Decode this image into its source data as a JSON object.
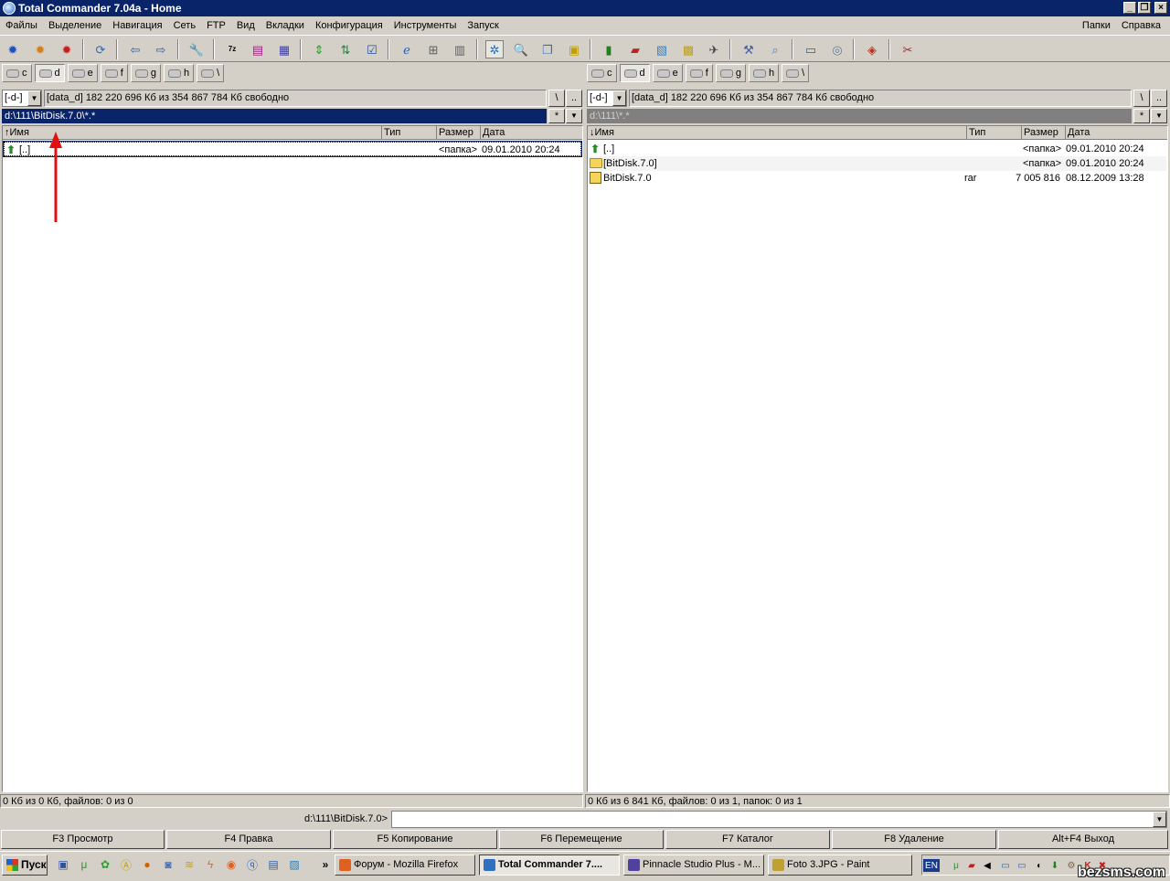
{
  "window": {
    "title": "Total Commander 7.04a - Home"
  },
  "menu": {
    "items": [
      "Файлы",
      "Выделение",
      "Навигация",
      "Сеть",
      "FTP",
      "Вид",
      "Вкладки",
      "Конфигурация",
      "Инструменты",
      "Запуск"
    ],
    "right": [
      "Папки",
      "Справка"
    ]
  },
  "toolbar": {
    "icons": [
      "gear-blue-icon",
      "gear-orange-icon",
      "gear-red-icon",
      "refresh-icon",
      "back-icon",
      "forward-icon",
      "wrench-icon",
      "7z-icon",
      "archive-icon",
      "unpack-icon",
      "sync-icon",
      "compare-icon",
      "checklist-icon",
      "ie-icon",
      "network-icon",
      "grid-icon",
      "star-icon",
      "search-icon",
      "copy-names-icon",
      "calendar-icon",
      "book-icon",
      "red-book-icon",
      "gallery-icon",
      "photo-icon",
      "plane-icon",
      "tools-icon",
      "magnifier-icon",
      "window-icon",
      "cd-icon",
      "paint-icon",
      "scissors-icon"
    ]
  },
  "left": {
    "drives": [
      "c",
      "d",
      "e",
      "f",
      "g",
      "h",
      "\\"
    ],
    "active_drive": "d",
    "drive_combo": "[-d-]",
    "free_info": "[data_d]  182 220 696 Кб из 354 867 784 Кб свободно",
    "root_btn": "\\",
    "up_btn": "..",
    "path": "d:\\111\\BitDisk.7.0\\*.*",
    "filter_btn": "*",
    "columns": {
      "name": "↑Имя",
      "type": "Тип",
      "size": "Размер",
      "date": "Дата"
    },
    "rows": [
      {
        "name": "[..]",
        "type": "",
        "size": "<папка>",
        "date": "09.01.2010 20:24"
      }
    ],
    "status": "0 Кб из 0 Кб, файлов: 0 из 0"
  },
  "right": {
    "drives": [
      "c",
      "d",
      "e",
      "f",
      "g",
      "h",
      "\\"
    ],
    "active_drive": "d",
    "drive_combo": "[-d-]",
    "free_info": "[data_d]  182 220 696 Кб из 354 867 784 Кб свободно",
    "root_btn": "\\",
    "up_btn": "..",
    "path": "d:\\111\\*.*",
    "filter_btn": "*",
    "columns": {
      "name": "↓Имя",
      "type": "Тип",
      "size": "Размер",
      "date": "Дата"
    },
    "rows": [
      {
        "name": "[..]",
        "type": "",
        "size": "<папка>",
        "date": "09.01.2010 20:24"
      },
      {
        "name": "[BitDisk.7.0]",
        "type": "",
        "size": "<папка>",
        "date": "09.01.2010 20:24"
      },
      {
        "name": "BitDisk.7.0",
        "type": "rar",
        "size": "7 005 816",
        "date": "08.12.2009 13:28"
      }
    ],
    "status": "0 Кб из 6 841 Кб, файлов: 0 из 1, папок: 0 из 1"
  },
  "cmdline": {
    "path": "d:\\111\\BitDisk.7.0>",
    "value": ""
  },
  "fkeys": [
    "F3 Просмотр",
    "F4 Правка",
    "F5 Копирование",
    "F6 Перемещение",
    "F7 Каталог",
    "F8 Удаление",
    "Alt+F4 Выход"
  ],
  "taskbar": {
    "start": "Пуск",
    "chevron": "»",
    "tasks": [
      {
        "label": "Форум - Mozilla Firefox",
        "color": "#e06020"
      },
      {
        "label": "Total Commander 7....",
        "color": "#3070c0"
      },
      {
        "label": "Pinnacle Studio Plus - M...",
        "color": "#5040a0"
      },
      {
        "label": "Foto 3.JPG - Paint",
        "color": "#c0a030"
      }
    ],
    "lang": "EN",
    "watermark": "bezsms.com"
  },
  "colors": {
    "title_bg": "#0a246a",
    "arrow": "#e01010",
    "inactive_path": "#808080"
  }
}
